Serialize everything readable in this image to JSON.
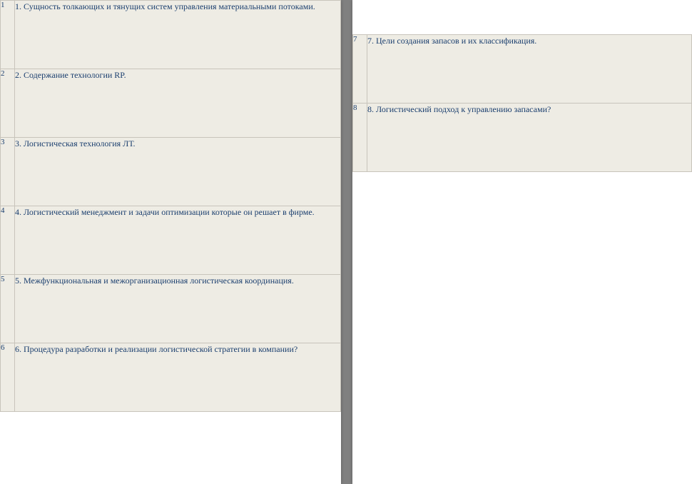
{
  "left_page": {
    "rows": [
      {
        "num": "1",
        "text": "1. Сущность толкающих и тянущих систем управления материальными потоками."
      },
      {
        "num": "2",
        "text": "2. Содержание технологии RP."
      },
      {
        "num": "3",
        "text": "3. Логистическая технология ЛТ."
      },
      {
        "num": "4",
        "text": "4. Логистический менеджмент и задачи оптимизации которые он решает в фирме."
      },
      {
        "num": "5",
        "text": "5. Межфункциональная и межорганизационная логистическая координация."
      },
      {
        "num": "6",
        "text": "6. Процедура разработки и реализации логистической стратегии в компании?"
      }
    ]
  },
  "right_page": {
    "rows": [
      {
        "num": "7",
        "text": "7. Цели создания запасов и их классификация."
      },
      {
        "num": "8",
        "text": "8. Логистический подход к управлению запасами?"
      }
    ]
  }
}
